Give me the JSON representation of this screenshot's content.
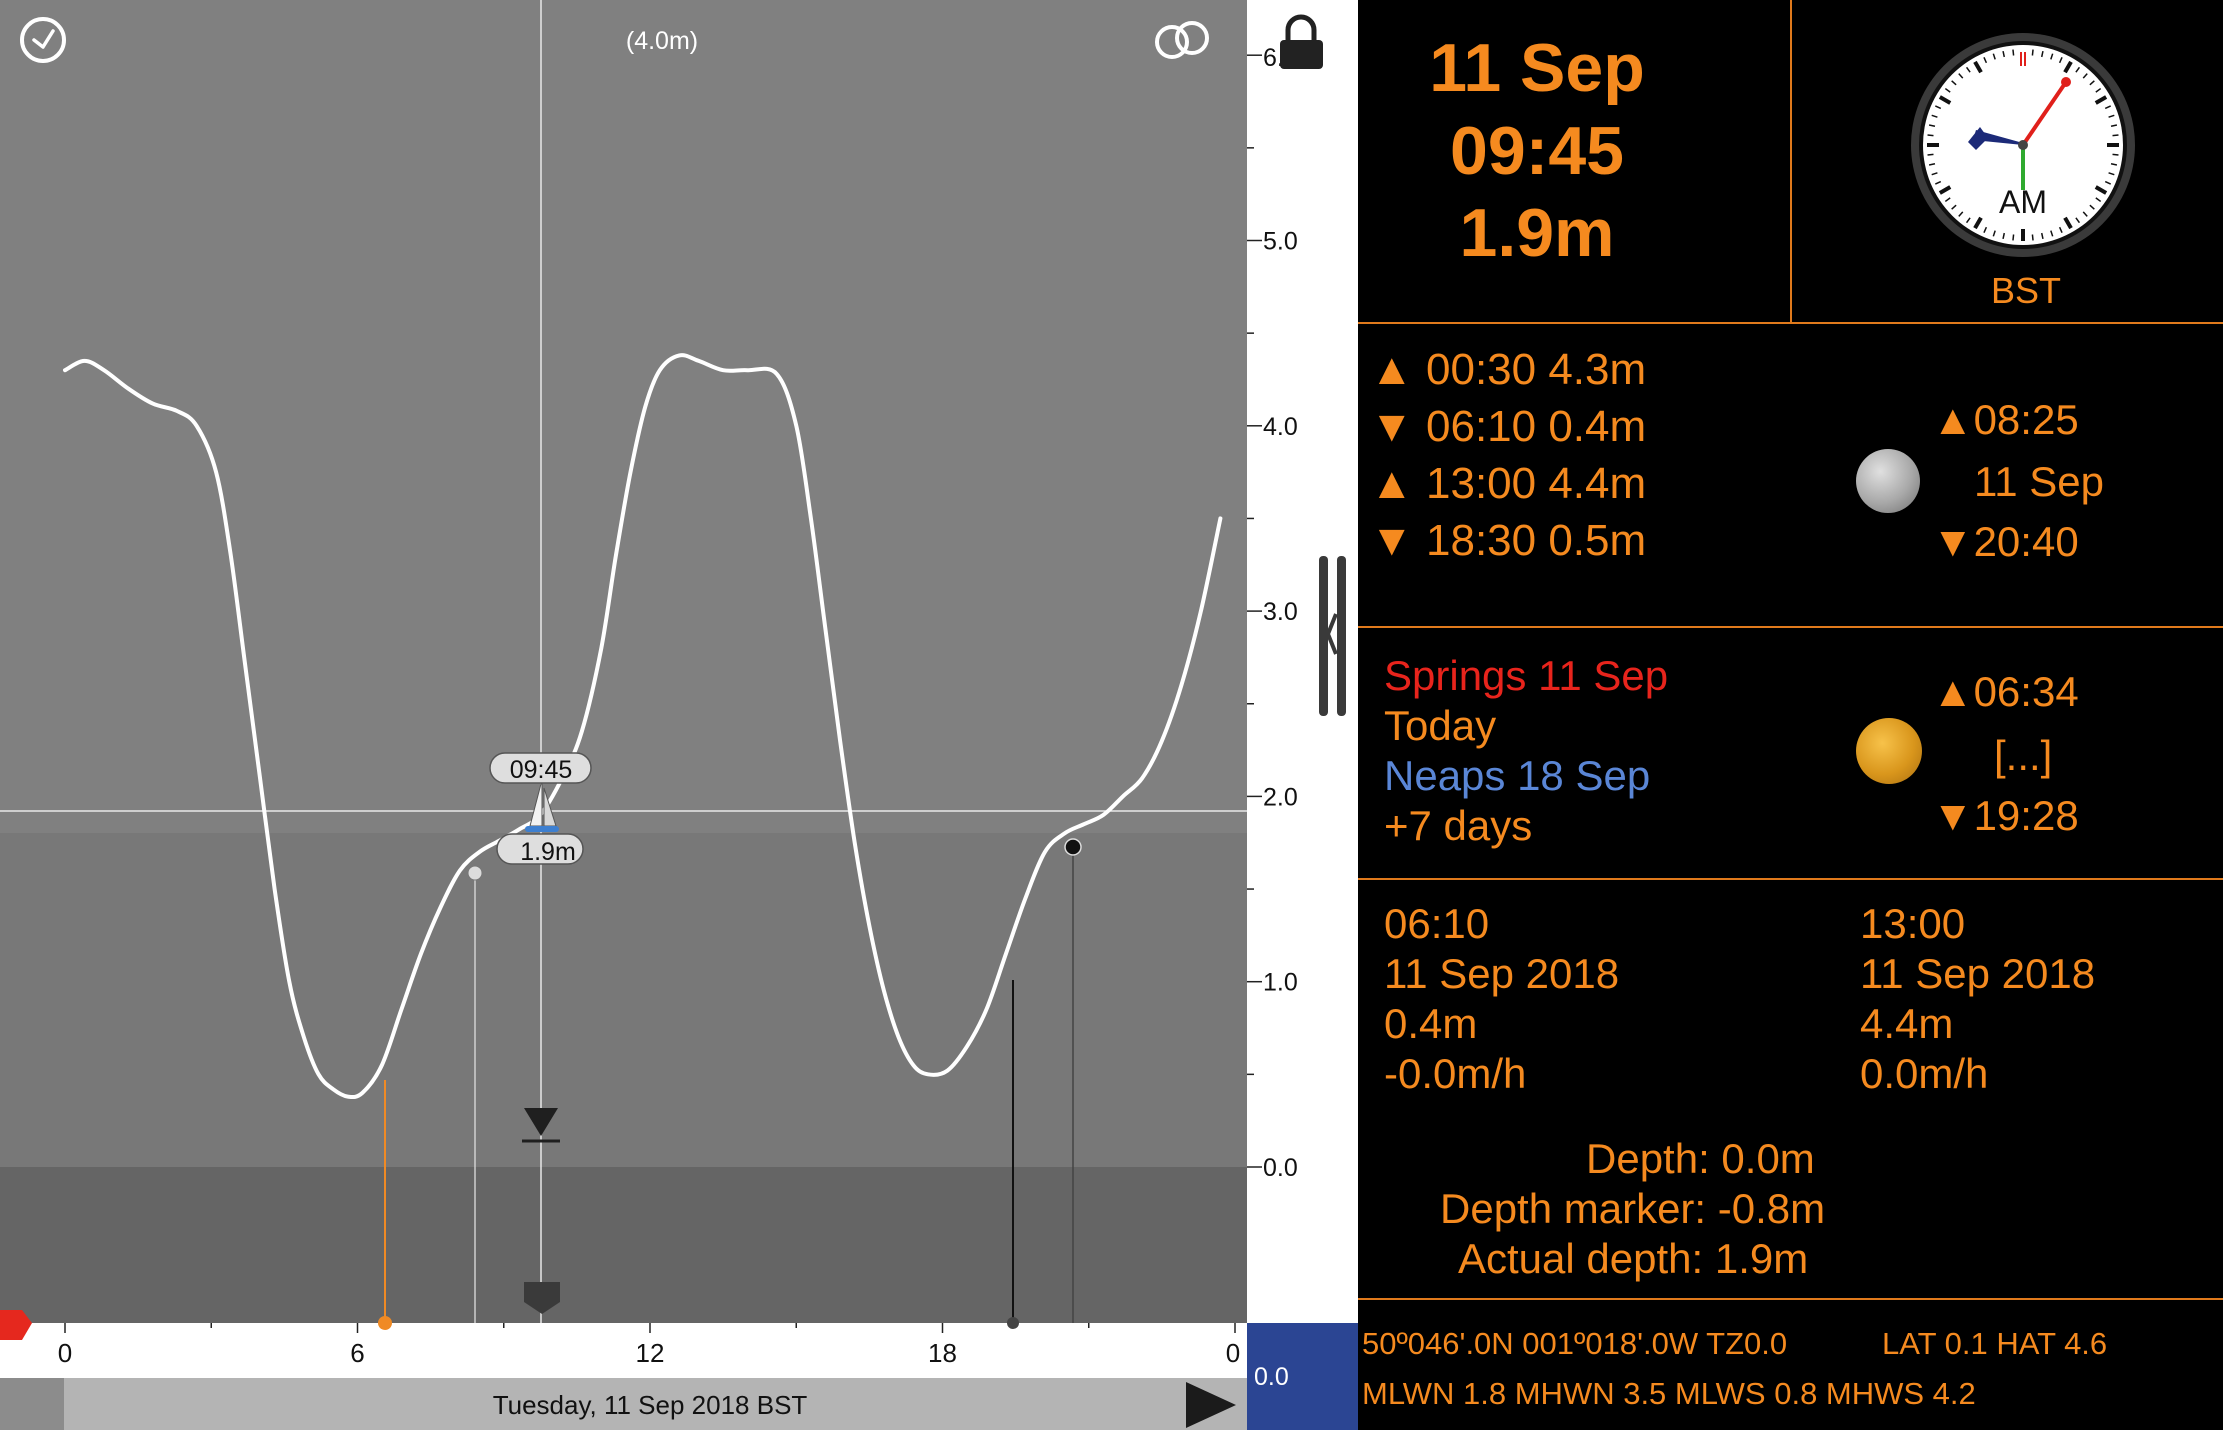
{
  "chart": {
    "top_caption": "(4.0m)",
    "cursor_time": "09:45",
    "cursor_height": "1.9m",
    "scale_labels": [
      "6.",
      "5.0",
      "4.0",
      "3.0",
      "2.0",
      "1.0",
      "0.0"
    ],
    "hour_labels": [
      "0",
      "6",
      "12",
      "18",
      "0"
    ],
    "date_caption": "Tuesday, 11 Sep 2018 BST",
    "depth_offset": "0.0",
    "icons": {
      "clock": "clock-icon",
      "rings": "rings-icon",
      "lock": "lock-icon",
      "play": "play-icon",
      "handle": "panel-handle-icon",
      "boat": "sailboat-icon"
    },
    "colors": {
      "plot_bg": "#808080",
      "curve": "#ffffff",
      "low_marker": "#f08a24",
      "next_marker": "#e5281e",
      "offset_box": "#2b4593"
    }
  },
  "chart_data": {
    "type": "line",
    "title": "(4.0m)",
    "xlabel": "Tuesday, 11 Sep 2018 BST",
    "ylabel": "",
    "x_ticks": [
      0,
      6,
      12,
      18,
      24
    ],
    "y_ticks": [
      0.0,
      1.0,
      2.0,
      3.0,
      4.0,
      5.0,
      6.0
    ],
    "xlim": [
      0,
      24
    ],
    "ylim": [
      -0.8,
      6.2
    ],
    "series": [
      {
        "x": [
          0.0,
          0.4,
          0.8,
          1.3,
          1.8,
          2.3,
          2.7,
          3.1,
          3.4,
          3.7,
          4.0,
          4.3,
          4.6,
          4.9,
          5.2,
          5.5,
          5.8,
          6.1,
          6.5,
          6.9,
          7.3,
          7.7,
          8.1,
          8.5,
          8.9,
          9.3,
          9.75,
          10.2,
          10.6,
          11.0,
          11.3,
          11.6,
          11.9,
          12.2,
          12.6,
          13.0,
          13.5,
          14.0,
          14.6,
          15.0,
          15.3,
          15.6,
          15.9,
          16.2,
          16.5,
          16.8,
          17.1,
          17.4,
          17.7,
          18.1,
          18.5,
          18.9,
          19.3,
          19.7,
          20.1,
          20.5,
          20.9,
          21.3,
          21.7,
          22.1,
          22.5,
          22.9,
          23.3,
          23.7
        ],
        "y": [
          4.3,
          4.35,
          4.3,
          4.2,
          4.12,
          4.08,
          4.0,
          3.75,
          3.3,
          2.7,
          2.1,
          1.5,
          1.0,
          0.7,
          0.5,
          0.42,
          0.38,
          0.4,
          0.55,
          0.85,
          1.15,
          1.4,
          1.6,
          1.7,
          1.76,
          1.82,
          1.9,
          2.1,
          2.35,
          2.8,
          3.3,
          3.75,
          4.1,
          4.3,
          4.38,
          4.35,
          4.3,
          4.3,
          4.28,
          4.0,
          3.5,
          2.9,
          2.3,
          1.75,
          1.3,
          0.95,
          0.7,
          0.55,
          0.5,
          0.52,
          0.65,
          0.85,
          1.15,
          1.45,
          1.7,
          1.8,
          1.85,
          1.9,
          2.0,
          2.1,
          2.3,
          2.6,
          3.0,
          3.5
        ]
      }
    ],
    "annotations": [
      "09:45",
      "1.9m"
    ],
    "grid": false
  },
  "info": {
    "date": "11 Sep",
    "time": "09:45",
    "height": "1.9m",
    "clock_label": "AM",
    "timezone": "BST",
    "tides": [
      {
        "dir": "▲",
        "text": "00:30 4.3m"
      },
      {
        "dir": "▼",
        "text": "06:10 0.4m"
      },
      {
        "dir": "▲",
        "text": "13:00 4.4m"
      },
      {
        "dir": "▼",
        "text": "18:30 0.5m"
      }
    ],
    "moon": {
      "rise": "▲08:25",
      "date": "11 Sep",
      "set": "▼20:40"
    },
    "springs": "Springs 11 Sep",
    "today": "Today",
    "neaps": "Neaps 18 Sep",
    "days": "+7 days",
    "sun": {
      "rise": "▲06:34",
      "mid": "[...]",
      "set": "▼19:28"
    },
    "low_detail": {
      "time": "06:10",
      "date": "11 Sep 2018",
      "height": "0.4m",
      "rate": "-0.0m/h"
    },
    "high_detail": {
      "time": "13:00",
      "date": "11 Sep 2018",
      "height": "4.4m",
      "rate": "0.0m/h"
    },
    "depth": "Depth: 0.0m",
    "depth_marker": "Depth marker: -0.8m",
    "actual_depth": "Actual depth: 1.9m",
    "position": "50º046'.0N 001º018'.0W TZ0.0",
    "lat_hat": "LAT 0.1 HAT 4.6",
    "levels": "MLWN 1.8 MHWN 3.5 MLWS 0.8 MHWS 4.2",
    "colors": {
      "accent": "#f58a1f",
      "springs": "#e8241c",
      "neaps": "#5a86d6",
      "today": "#f58a1f"
    }
  }
}
